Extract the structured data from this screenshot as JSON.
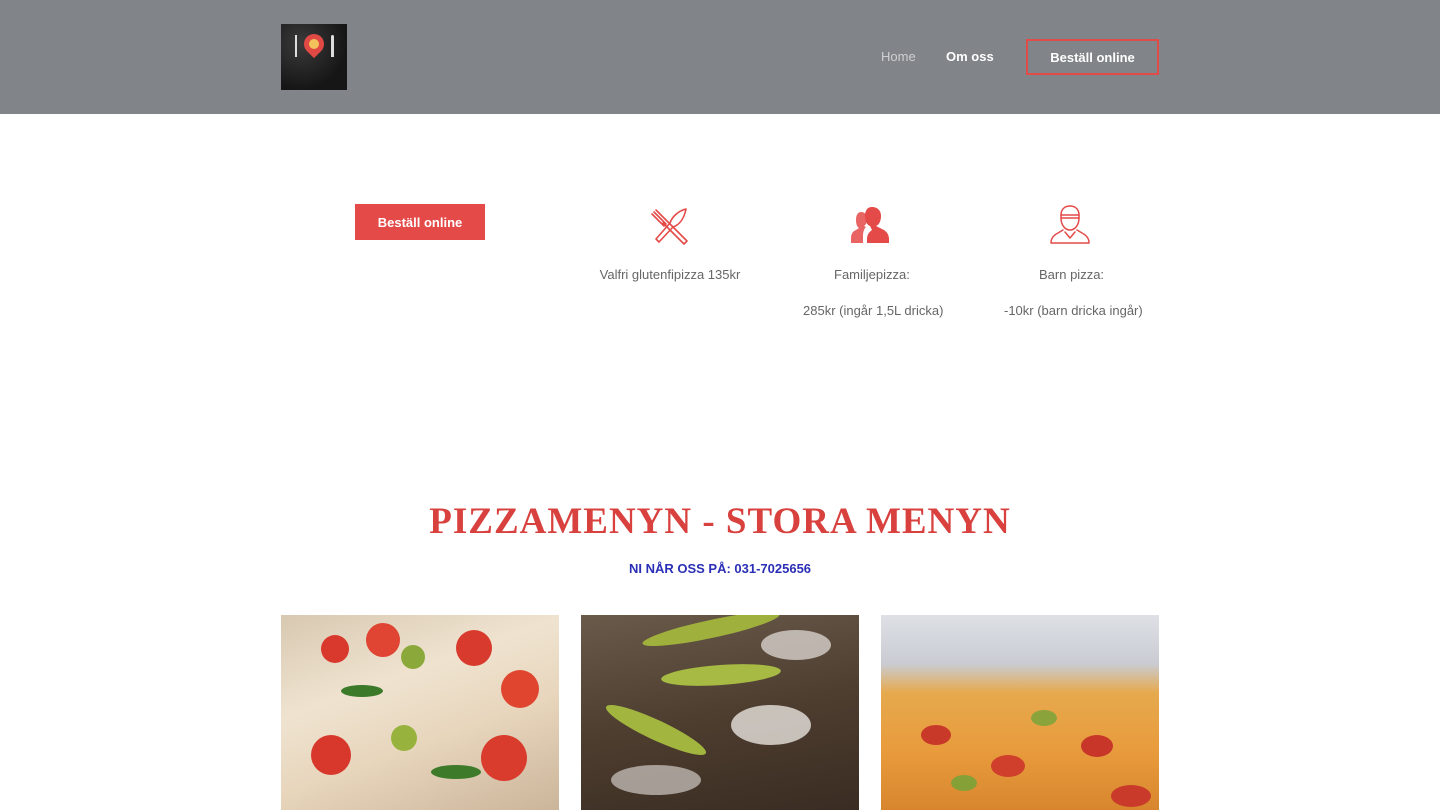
{
  "header": {
    "logo_alt": "Lilla Ristorante logo",
    "nav": {
      "home": "Home",
      "about": "Om oss",
      "order": "Beställ online"
    }
  },
  "features": {
    "order_button": "Beställ online",
    "items": [
      {
        "icon": "fork-knife-icon",
        "line1": "Valfri glutenfipizza   135kr",
        "line2": ""
      },
      {
        "icon": "people-icon",
        "line1": "Familjepizza:",
        "line2": "285kr (ingår 1,5L dricka)"
      },
      {
        "icon": "child-chef-icon",
        "line1": "Barn pizza:",
        "line2": "-10kr (barn dricka ingår)"
      }
    ]
  },
  "menu": {
    "title": "PIZZAMENYN - STORA MENYN",
    "phone": "NI NÅR OSS PÅ: 031-7025656"
  },
  "colors": {
    "header_bg": "#818488",
    "accent": "#e44a48",
    "title": "#d8413e",
    "phone": "#2a2fb5"
  }
}
